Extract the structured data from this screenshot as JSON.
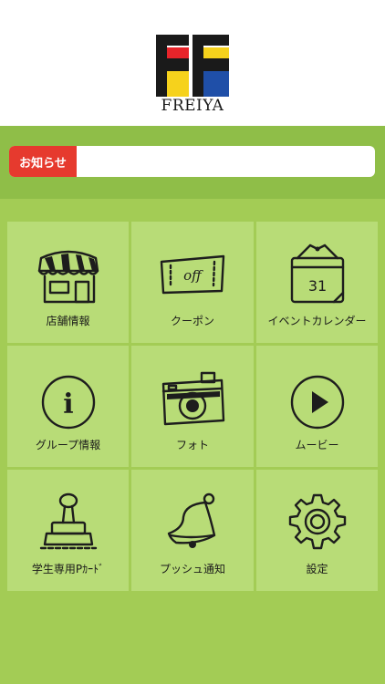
{
  "brand": {
    "name": "FREIYA"
  },
  "notice": {
    "badge": "お知らせ",
    "text": ""
  },
  "menu": [
    {
      "label": "店舗情報",
      "icon": "store-icon"
    },
    {
      "label": "クーポン",
      "icon": "coupon-icon"
    },
    {
      "label": "イベントカレンダー",
      "icon": "calendar-icon",
      "calendar_day": "31"
    },
    {
      "label": "グループ情報",
      "icon": "info-icon",
      "info_glyph": "i"
    },
    {
      "label": "フォト",
      "icon": "camera-icon"
    },
    {
      "label": "ムービー",
      "icon": "play-icon"
    },
    {
      "label": "学生専用Pｶｰﾄﾞ",
      "icon": "stamp-icon"
    },
    {
      "label": "プッシュ通知",
      "icon": "bell-icon"
    },
    {
      "label": "設定",
      "icon": "gear-icon"
    }
  ],
  "coupon_text": "off",
  "colors": {
    "background": "#a3cc55",
    "notice_band": "#8fbe48",
    "tile": "#b8dc77",
    "badge": "#e63a2e",
    "logo_red": "#e8242a",
    "logo_yellow": "#f6d21c",
    "logo_blue": "#1f4fa8",
    "logo_black": "#1a1a1a"
  }
}
